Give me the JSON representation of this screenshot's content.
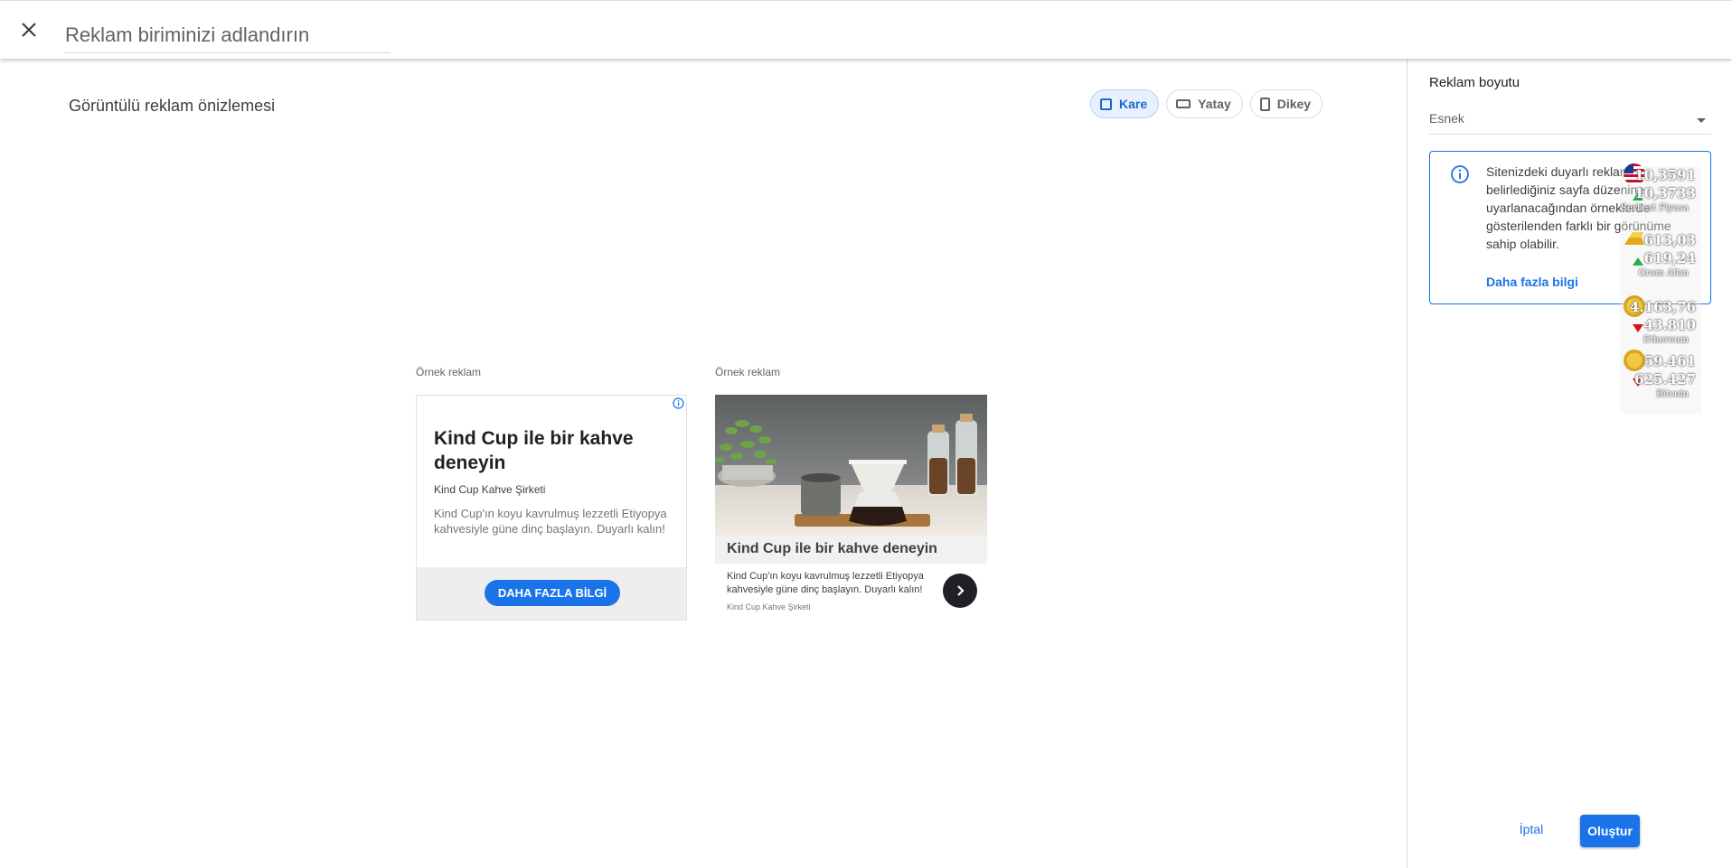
{
  "header": {
    "close_icon": "close-icon",
    "name_placeholder": "Reklam biriminizi adlandırın"
  },
  "preview": {
    "title": "Görüntülü reklam önizlemesi",
    "shapes": [
      {
        "label": "Kare",
        "icon": "square-icon",
        "active": true
      },
      {
        "label": "Yatay",
        "icon": "landscape-icon",
        "active": false
      },
      {
        "label": "Dikey",
        "icon": "portrait-icon",
        "active": false
      }
    ],
    "ad_label": "Örnek reklam",
    "ad1": {
      "headline": "Kind Cup ile bir kahve deneyin",
      "company": "Kind Cup Kahve Şirketi",
      "description": "Kind Cup'ın koyu kavrulmuş lezzetli Etiyopya kahvesiyle güne dinç başlayın. Duyarlı kalın!",
      "cta": "DAHA FAZLA BİLGİ"
    },
    "ad2": {
      "headline": "Kind Cup ile bir kahve deneyin",
      "description": "Kind Cup'ın koyu kavrulmuş lezzetli Etiyopya kahvesiyle güne dinç başlayın. Duyarlı kalın!",
      "company": "Kind Cup Kahve Şirketi"
    }
  },
  "side": {
    "title": "Reklam boyutu",
    "size_value": "Esnek",
    "notice_text": "Sitenizdeki duyarlı reklamlar, belirlediğiniz sayfa düzenine uyarlanacağından örneklerde gösterilenden farklı bir görünüme sahip olabilir.",
    "notice_link": "Daha fazla bilgi",
    "cancel": "İptal",
    "create": "Oluştur"
  },
  "ticker": [
    {
      "v1": "10,3591",
      "v2": "10,3733",
      "name": "Serbest Piyasa",
      "icon": "us-flag-icon",
      "trend": "up"
    },
    {
      "v1": "613,03",
      "v2": "619,24",
      "name": "Gram Altın",
      "icon": "gold-bar-icon",
      "trend": "up"
    },
    {
      "v1": "4.163,76",
      "v2": "43.810",
      "name": "Ethereum",
      "icon": "coin-icon",
      "trend": "down"
    },
    {
      "v1": "59.461",
      "v2": "625.427",
      "name": "Bitcoin",
      "icon": "coin-icon",
      "trend": "down"
    }
  ],
  "colors": {
    "accent": "#1a73e8",
    "chip_active_bg": "#e8f0fe",
    "up": "#22b14c",
    "down": "#e01010"
  }
}
